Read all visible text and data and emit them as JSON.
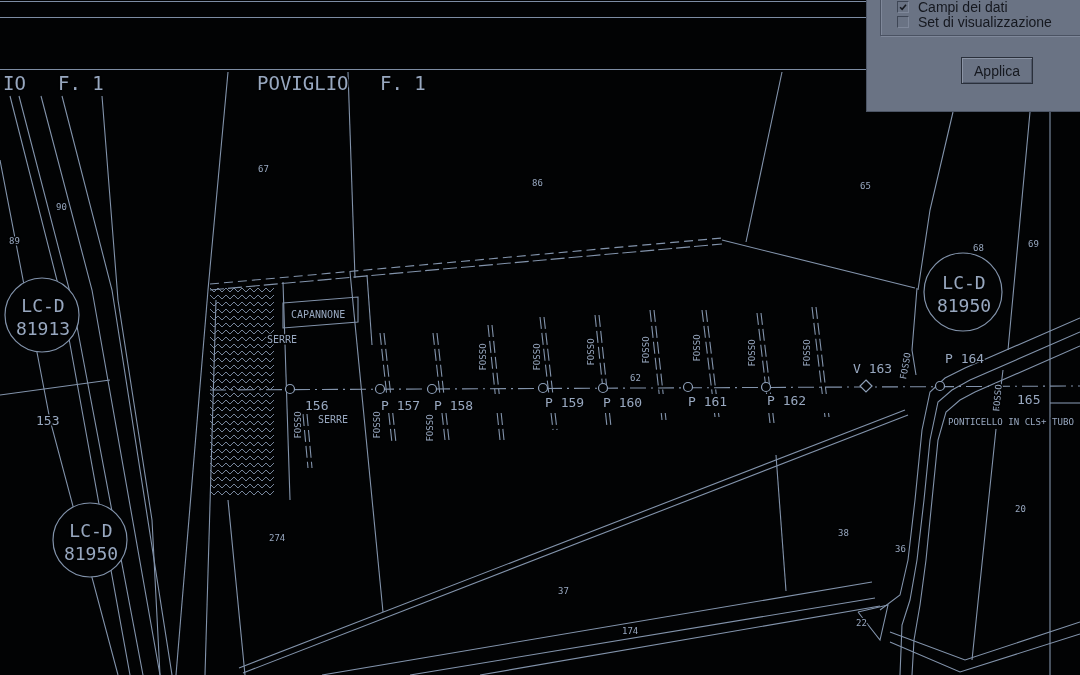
{
  "drawing": {
    "sheet_labels": [
      {
        "text": "IO"
      },
      {
        "text": "F. 1"
      },
      {
        "text": "POVIGLIO"
      },
      {
        "text": "F. 1"
      }
    ],
    "parcel_numbers": [
      "67",
      "86",
      "65",
      "90",
      "68",
      "69",
      "89",
      "62",
      "274",
      "38",
      "20",
      "36",
      "37",
      "22",
      "174"
    ],
    "callouts": [
      {
        "code": "LC-D",
        "number": "81913"
      },
      {
        "code": "LC-D",
        "number": "81950"
      },
      {
        "code": "LC-D",
        "number": "81950"
      }
    ],
    "building_label": "CAPANNONE",
    "area_labels": [
      "SERRE",
      "SERRE"
    ],
    "stations": [
      "153",
      "156",
      "P 157",
      "P 158",
      "P 159",
      "P 160",
      "P 161",
      "P 162",
      "V 163",
      "P 164",
      "165"
    ],
    "ditch_labels": [
      "FOSSO",
      "FOSSO",
      "FOSSO",
      "FOSSO",
      "FOSSO",
      "FOSSO",
      "FOSSO",
      "FOSSO",
      "FOSSO",
      "FOSSO",
      "FOSSO",
      "FOSSO"
    ],
    "bridge_note": "PONTICELLO IN CLS+ TUBO"
  },
  "panel": {
    "options": [
      {
        "label": "Campi dei dati",
        "checked": true
      },
      {
        "label": "Set di visualizzazione",
        "checked": false
      }
    ],
    "apply_button": "Applica"
  }
}
